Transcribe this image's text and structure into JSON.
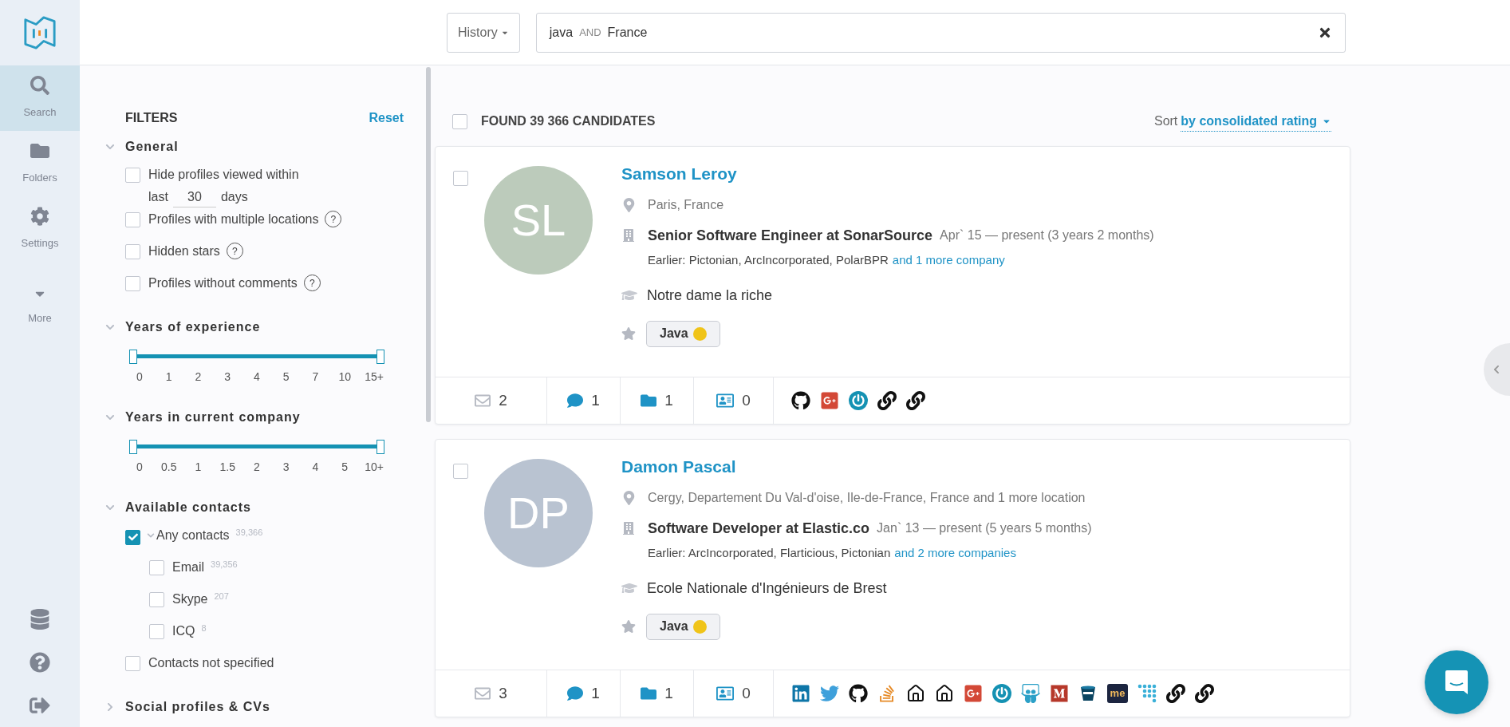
{
  "nav": {
    "items": [
      {
        "kind": "search",
        "label": "Search",
        "selected": true
      },
      {
        "kind": "folders",
        "label": "Folders",
        "selected": false
      },
      {
        "kind": "settings",
        "label": "Settings",
        "selected": false
      },
      {
        "kind": "more",
        "label": "More",
        "selected": false
      }
    ],
    "bottom_icons": [
      {
        "kind": "coins"
      },
      {
        "kind": "help"
      },
      {
        "kind": "logout"
      }
    ]
  },
  "search": {
    "history_button": "History",
    "query": [
      {
        "kind": "term",
        "text": "java"
      },
      {
        "kind": "operator",
        "text": "AND"
      },
      {
        "kind": "term",
        "text": "France"
      }
    ]
  },
  "filters": {
    "title": "FILTERS",
    "reset": "Reset",
    "sections": [
      {
        "kind": "checks",
        "title": "General",
        "expanded": true,
        "items": [
          {
            "label": "Hide profiles viewed within",
            "checked": false,
            "days_prefix": "last",
            "days_value": "30",
            "days_suffix": "days"
          },
          {
            "label": "Profiles with multiple locations",
            "checked": false,
            "help": "?"
          },
          {
            "label": "Hidden stars",
            "checked": false,
            "help": "?"
          },
          {
            "label": "Profiles without comments",
            "checked": false,
            "help": "?"
          }
        ]
      },
      {
        "kind": "range",
        "title": "Years of experience",
        "expanded": true,
        "handles": [
          {
            "level": 0
          },
          {
            "level": 1
          }
        ],
        "ticks": [
          "0",
          "1",
          "2",
          "3",
          "4",
          "5",
          "7",
          "10",
          "15+"
        ]
      },
      {
        "kind": "range",
        "title": "Years in current company",
        "expanded": true,
        "handles": [
          {
            "level": 0
          },
          {
            "level": 1
          }
        ],
        "ticks": [
          "0",
          "0.5",
          "1",
          "1.5",
          "2",
          "3",
          "4",
          "5",
          "10+"
        ]
      },
      {
        "kind": "checks",
        "title": "Available contacts",
        "expanded": true,
        "items": [
          {
            "label": "Any contacts",
            "count": "39,366",
            "checked": true,
            "expanded": true,
            "children": [
              {
                "label": "Email",
                "count": "39,356",
                "checked": false
              },
              {
                "label": "Skype",
                "count": "207",
                "checked": false
              },
              {
                "label": "ICQ",
                "count": "8",
                "checked": false
              }
            ]
          },
          {
            "label": "Contacts not specified",
            "checked": false
          }
        ]
      },
      {
        "title": "Social profiles & CVs",
        "expanded": false
      }
    ]
  },
  "results": {
    "found": "FOUND 39 366 CANDIDATES",
    "all_checked": false,
    "sort_label": "Sort",
    "sort_value": "by consolidated rating",
    "candidates": [
      {
        "initials": "SL",
        "color": "#bccbbb",
        "checked": false,
        "name": "Samson Leroy",
        "location": "Paris, France",
        "job": "Senior Software Engineer at SonarSource",
        "period": "Apr` 15 — present (3 years 2 months)",
        "earlier": "Earlier: Pictonian, ArcIncorporated, PolarBPR",
        "earlier_more": "and 1 more company",
        "education": "Notre dame la riche",
        "skills": [
          "Java"
        ],
        "stats": [
          {
            "kind": "mail",
            "value": "2"
          },
          {
            "kind": "comments",
            "value": "1"
          },
          {
            "kind": "folders",
            "value": "1"
          },
          {
            "kind": "contacts",
            "value": "0"
          }
        ],
        "links": [
          {
            "kind": "github"
          },
          {
            "kind": "gplus"
          },
          {
            "kind": "power"
          },
          {
            "kind": "link"
          },
          {
            "kind": "link"
          }
        ]
      },
      {
        "initials": "DP",
        "color": "#b9c3d1",
        "checked": false,
        "name": "Damon Pascal",
        "location": "Cergy, Departement Du Val-d'oise, Ile-de-France, France and 1 more location",
        "job": "Software Developer at Elastic.co",
        "period": "Jan` 13 — present (5 years 5 months)",
        "earlier": "Earlier: ArcIncorporated, Flarticious, Pictonian",
        "earlier_more": "and 2 more companies",
        "education": "Ecole Nationale d'Ingénieurs de Brest",
        "skills": [
          "Java"
        ],
        "stats": [
          {
            "kind": "mail",
            "value": "3"
          },
          {
            "kind": "comments",
            "value": "1"
          },
          {
            "kind": "folders",
            "value": "1"
          },
          {
            "kind": "contacts",
            "value": "0"
          }
        ],
        "links": [
          {
            "kind": "linkedin"
          },
          {
            "kind": "twitter"
          },
          {
            "kind": "github"
          },
          {
            "kind": "stack"
          },
          {
            "kind": "house"
          },
          {
            "kind": "house"
          },
          {
            "kind": "gplus"
          },
          {
            "kind": "power"
          },
          {
            "kind": "slides"
          },
          {
            "kind": "medium"
          },
          {
            "kind": "bucket"
          },
          {
            "kind": "me",
            "label": "me"
          },
          {
            "kind": "dots"
          },
          {
            "kind": "link"
          },
          {
            "kind": "link"
          }
        ]
      }
    ]
  }
}
